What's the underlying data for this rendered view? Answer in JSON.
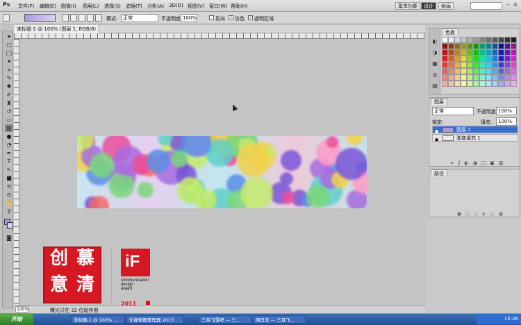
{
  "app": {
    "logo": "Ps"
  },
  "menu": [
    "文件(F)",
    "编辑(E)",
    "图像(I)",
    "图层(L)",
    "选择(S)",
    "滤镜(T)",
    "分析(A)",
    "3D(D)",
    "视图(V)",
    "窗口(W)",
    "帮助(H)"
  ],
  "workspaces": [
    "基本功能",
    "设计",
    "绘画"
  ],
  "workspace_active": "设计",
  "search_placeholder": "",
  "options": {
    "mode_label": "模式:",
    "mode_value": "正常",
    "opacity_label": "不透明度:",
    "opacity_value": "100%",
    "reverse": "反向",
    "dither": "仿色",
    "transparency": "透明区域"
  },
  "document": {
    "tab": "未标题-1 @ 100% (图层 1, RGB/8)",
    "zoom": "100%",
    "status": "曝光只在 32 位起作用"
  },
  "panels": {
    "swatches_tab": "色板",
    "layers_tab": "图层",
    "layers_mode": "正常",
    "layers_opacity_label": "不透明度:",
    "layers_opacity": "100%",
    "lock_label": "锁定:",
    "fill_label": "填充:",
    "fill_value": "100%",
    "layers": [
      {
        "name": "图层 1",
        "selected": true
      },
      {
        "name": "渐变填充 1",
        "selected": false
      }
    ],
    "paths_tab": "路径"
  },
  "seal": {
    "chars": [
      "慕",
      "清",
      "创",
      "意"
    ]
  },
  "award": {
    "logo": "iF",
    "lines": [
      "communication",
      "design",
      "award"
    ],
    "year": "2011"
  },
  "taskbar": {
    "start": "开始",
    "tasks": [
      "未标题-1 @ 100% ...",
      "忙碌侧图管理器 2013",
      "三月飞雪吧 — 三...",
      "网日志 — 三月飞..."
    ],
    "clock": "15:28"
  }
}
